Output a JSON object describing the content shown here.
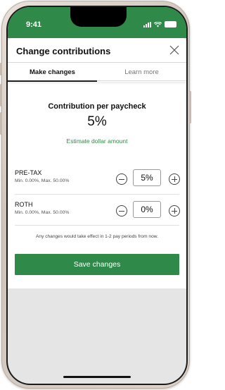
{
  "status_bar": {
    "time": "9:41"
  },
  "header": {
    "title": "Change contributions",
    "close_icon": "close-icon"
  },
  "tabs": [
    {
      "label": "Make changes",
      "active": true
    },
    {
      "label": "Learn more",
      "active": false
    }
  ],
  "contribution": {
    "label": "Contribution per paycheck",
    "value": "5%",
    "estimate_link": "Estimate dollar amount"
  },
  "rows": [
    {
      "title": "PRE-TAX",
      "subtitle": "Min. 0.00%, Max. 50.00%",
      "value": "5%"
    },
    {
      "title": "ROTH",
      "subtitle": "Min. 0.00%, Max. 50.00%",
      "value": "0%"
    }
  ],
  "note": "Any changes would take effect in 1-2 pay periods from now.",
  "save_button": "Save changes",
  "colors": {
    "accent": "#2f8a4a",
    "background": "#e5e5e5"
  }
}
